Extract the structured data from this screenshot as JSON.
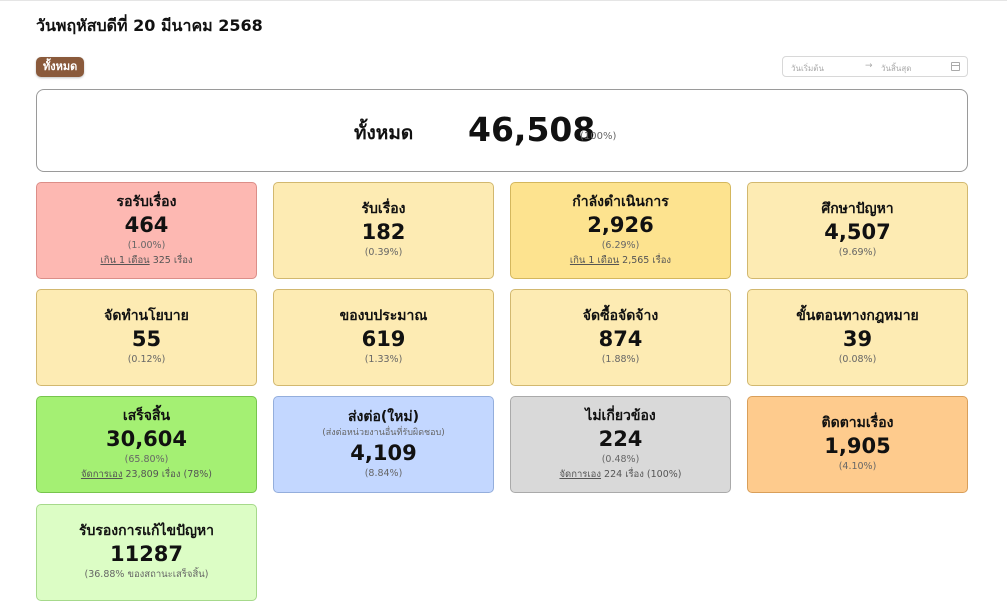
{
  "header": {
    "date_title": "วันพฤหัสบดีที่ 20 มีนาคม 2568",
    "filter_tag": "ทั้งหมด",
    "date_range": {
      "start_placeholder": "วันเริ่มต้น",
      "arrow": "→",
      "end_placeholder": "วันสิ้นสุด"
    }
  },
  "total": {
    "label": "ทั้งหมด",
    "value": "46,508",
    "percent": "(100%)"
  },
  "cards": [
    {
      "title": "รอรับเรื่อง",
      "value": "464",
      "percent": "(1.00%)",
      "extra_link": "เกิน 1 เดือน",
      "extra_text": "325 เรื่อง"
    },
    {
      "title": "รับเรื่อง",
      "value": "182",
      "percent": "(0.39%)"
    },
    {
      "title": "กำลังดำเนินการ",
      "value": "2,926",
      "percent": "(6.29%)",
      "extra_link": "เกิน 1 เดือน",
      "extra_text": "2,565 เรื่อง"
    },
    {
      "title": "ศึกษาปัญหา",
      "value": "4,507",
      "percent": "(9.69%)"
    },
    {
      "title": "จัดทำนโยบาย",
      "value": "55",
      "percent": "(0.12%)"
    },
    {
      "title": "ของบประมาณ",
      "value": "619",
      "percent": "(1.33%)"
    },
    {
      "title": "จัดซื้อจัดจ้าง",
      "value": "874",
      "percent": "(1.88%)"
    },
    {
      "title": "ขั้นตอนทางกฎหมาย",
      "value": "39",
      "percent": "(0.08%)"
    },
    {
      "title": "เสร็จสิ้น",
      "value": "30,604",
      "percent": "(65.80%)",
      "extra_link": "จัดการเอง",
      "extra_text": "23,809 เรื่อง (78%)"
    },
    {
      "title": "ส่งต่อ(ใหม่)",
      "subtitle": "(ส่งต่อหน่วยงานอื่นที่รับผิดชอบ)",
      "value": "4,109",
      "percent": "(8.84%)"
    },
    {
      "title": "ไม่เกี่ยวข้อง",
      "value": "224",
      "percent": "(0.48%)",
      "extra_link": "จัดการเอง",
      "extra_text": "224 เรื่อง (100%)"
    },
    {
      "title": "ติดตามเรื่อง",
      "value": "1,905",
      "percent": "(4.10%)"
    },
    {
      "title": "รับรองการแก้ไขปัญหา",
      "value": "11287",
      "percent": "(36.88% ของสถานะเสร็จสิ้น)"
    }
  ],
  "colors": {
    "default_card": "#fdebb3",
    "waiting": "#fdb8b2",
    "in_progress": "#fde38f",
    "completed": "#a4f073",
    "forwarded": "#c3d7ff",
    "irrelevant": "#d9d9d9",
    "follow_up": "#fecb8d",
    "certified": "#dcfdc5",
    "filter_tag": "#8a5a3b"
  }
}
